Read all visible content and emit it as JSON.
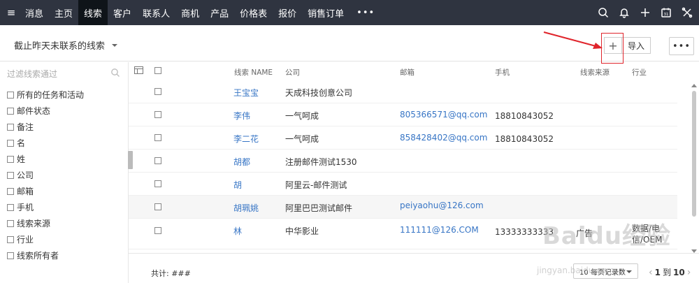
{
  "nav": {
    "items": [
      {
        "label": "消息"
      },
      {
        "label": "主页"
      },
      {
        "label": "线索",
        "active": true
      },
      {
        "label": "客户"
      },
      {
        "label": "联系人"
      },
      {
        "label": "商机"
      },
      {
        "label": "产品"
      },
      {
        "label": "价格表"
      },
      {
        "label": "报价"
      },
      {
        "label": "销售订单"
      }
    ],
    "more_label": "•••",
    "icons": [
      "search-icon",
      "bell-icon",
      "plus-icon",
      "calendar-icon",
      "tools-icon"
    ],
    "calendar_day": "31"
  },
  "view": {
    "selected": "截止昨天未联系的线索",
    "add_label": "+",
    "import_label": "导入",
    "more_label": "•••"
  },
  "filter": {
    "placeholder": "过滤线索通过",
    "items": [
      "所有的任务和活动",
      "邮件状态",
      "备注",
      "名",
      "姓",
      "公司",
      "邮箱",
      "手机",
      "线索来源",
      "行业",
      "线索所有者"
    ]
  },
  "table": {
    "headers": {
      "name": "线索 NAME",
      "company": "公司",
      "email": "邮箱",
      "phone": "手机",
      "source": "线索来源",
      "industry": "行业"
    },
    "rows": [
      {
        "name": "王宝宝",
        "company": "天成科技创意公司",
        "email": "",
        "phone": "",
        "source": "",
        "industry": ""
      },
      {
        "name": "李伟",
        "company": "一气呵成",
        "email": "805366571@qq.com",
        "phone": "18810843052",
        "source": "",
        "industry": ""
      },
      {
        "name": "李二花",
        "company": "一气呵成",
        "email": "858428402@qq.com",
        "phone": "18810843052",
        "source": "",
        "industry": ""
      },
      {
        "name": "胡都",
        "company": "注册邮件测试1530",
        "email": "",
        "phone": "",
        "source": "",
        "industry": ""
      },
      {
        "name": "胡",
        "company": "阿里云-邮件测试",
        "email": "",
        "phone": "",
        "source": "",
        "industry": ""
      },
      {
        "name": "胡珮姚",
        "company": "阿里巴巴测试邮件",
        "email": "peiyaohu@126.com",
        "phone": "",
        "source": "",
        "industry": ""
      },
      {
        "name": "林",
        "company": "中华影业",
        "email": "111111@126.COM",
        "phone": "13333333333",
        "source": "广告",
        "industry": "数据/电信/OEM"
      }
    ]
  },
  "footer": {
    "total": "共计: ###",
    "per_page": "10 每页记录数",
    "page_from": "1",
    "page_to_label": "到",
    "page_to": "10"
  },
  "watermark": {
    "brand": "Baidu经验",
    "url": "jingyan.baidu.com"
  },
  "colors": {
    "topbar": "#2f3440",
    "active_nav": "#0f1419",
    "link": "#3775c5",
    "highlight": "#e0242b"
  }
}
